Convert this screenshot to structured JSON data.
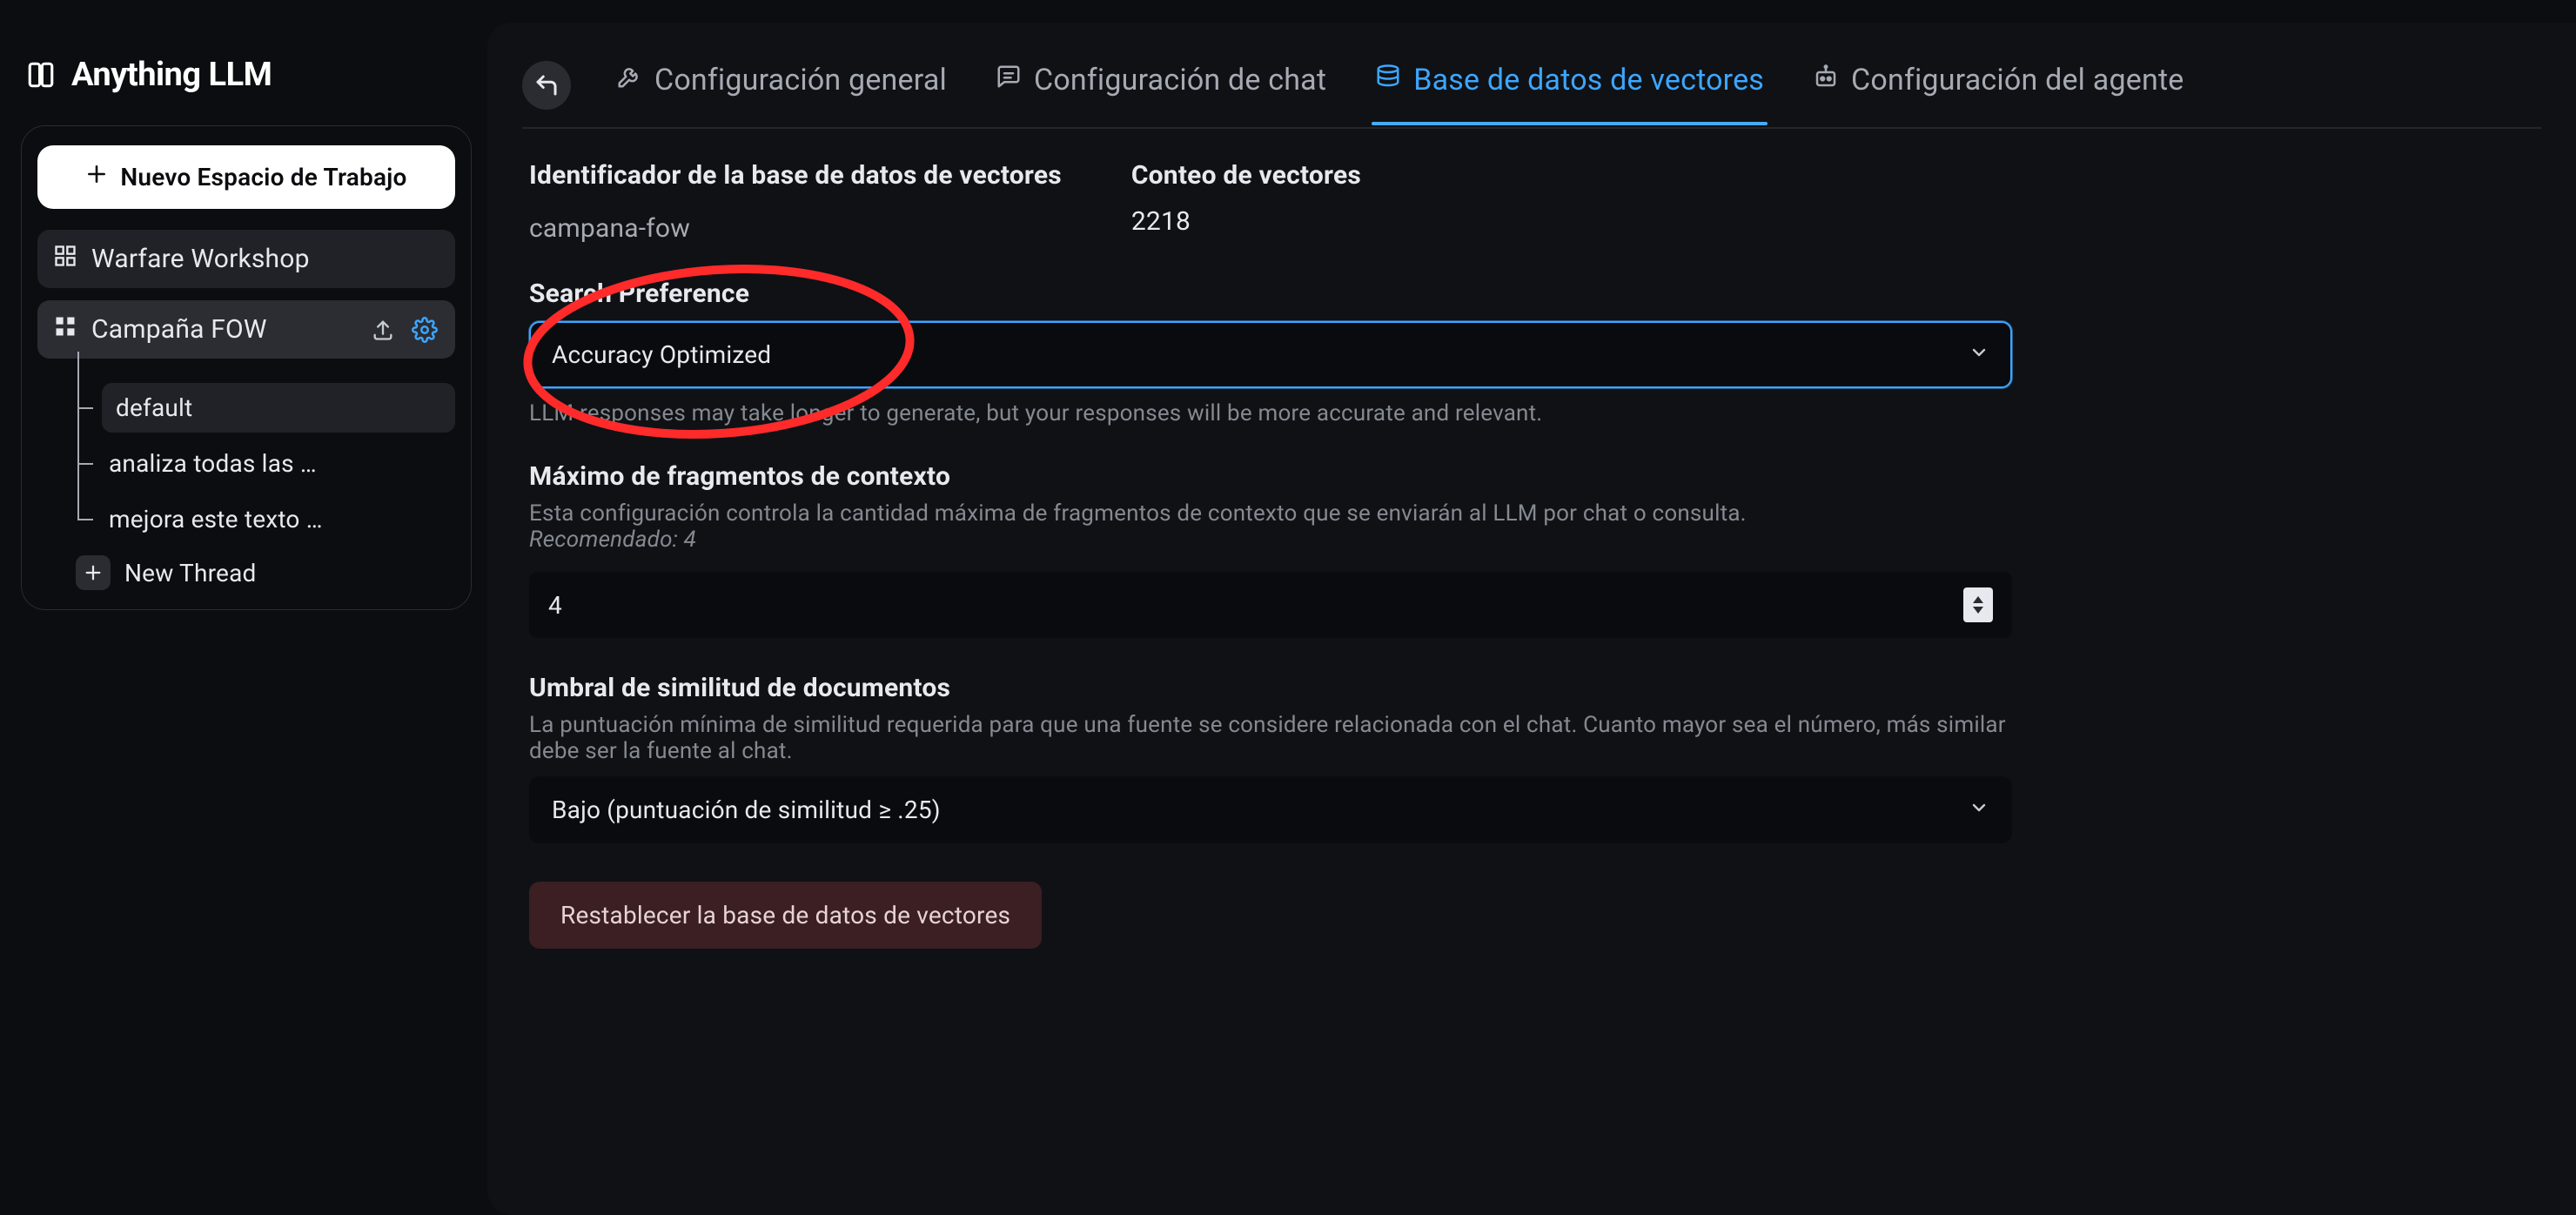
{
  "brand": {
    "title": "Anything LLM"
  },
  "sidebar": {
    "new_workspace_label": "Nuevo Espacio de Trabajo",
    "workspaces": [
      {
        "name": "Warfare Workshop",
        "active": false
      },
      {
        "name": "Campaña FOW",
        "active": true
      }
    ],
    "threads": [
      {
        "text": "default",
        "pill": true
      },
      {
        "text": "analiza todas las …",
        "pill": false
      },
      {
        "text": "mejora este texto …",
        "pill": false
      }
    ],
    "new_thread_label": "New Thread"
  },
  "tabs": [
    {
      "key": "general",
      "label": "Configuración general",
      "icon": "wrench",
      "active": false
    },
    {
      "key": "chat",
      "label": "Configuración de chat",
      "icon": "chat",
      "active": false
    },
    {
      "key": "vectors",
      "label": "Base de datos de vectores",
      "icon": "database",
      "active": true
    },
    {
      "key": "agent",
      "label": "Configuración del agente",
      "icon": "robot",
      "active": false
    }
  ],
  "vectors": {
    "identifier_label": "Identificador de la base de datos de vectores",
    "identifier_value": "campana-fow",
    "count_label": "Conteo de vectores",
    "count_value": "2218"
  },
  "search_pref": {
    "label": "Search Preference",
    "selected": "Accuracy Optimized",
    "helper": "LLM responses may take longer to generate, but your responses will be more accurate and relevant."
  },
  "max_fragments": {
    "label": "Máximo de fragmentos de contexto",
    "desc": "Esta configuración controla la cantidad máxima de fragmentos de contexto que se enviarán al LLM por chat o consulta.",
    "recommended": "Recomendado: 4",
    "value": "4"
  },
  "similarity": {
    "label": "Umbral de similitud de documentos",
    "desc": "La puntuación mínima de similitud requerida para que una fuente se considere relacionada con el chat. Cuanto mayor sea el número, más similar debe ser la fuente al chat.",
    "selected": "Bajo (puntuación de similitud ≥ .25)"
  },
  "reset_button_label": "Restablecer la base de datos de vectores",
  "annotation": {
    "circle_color": "#ff2a2a"
  }
}
